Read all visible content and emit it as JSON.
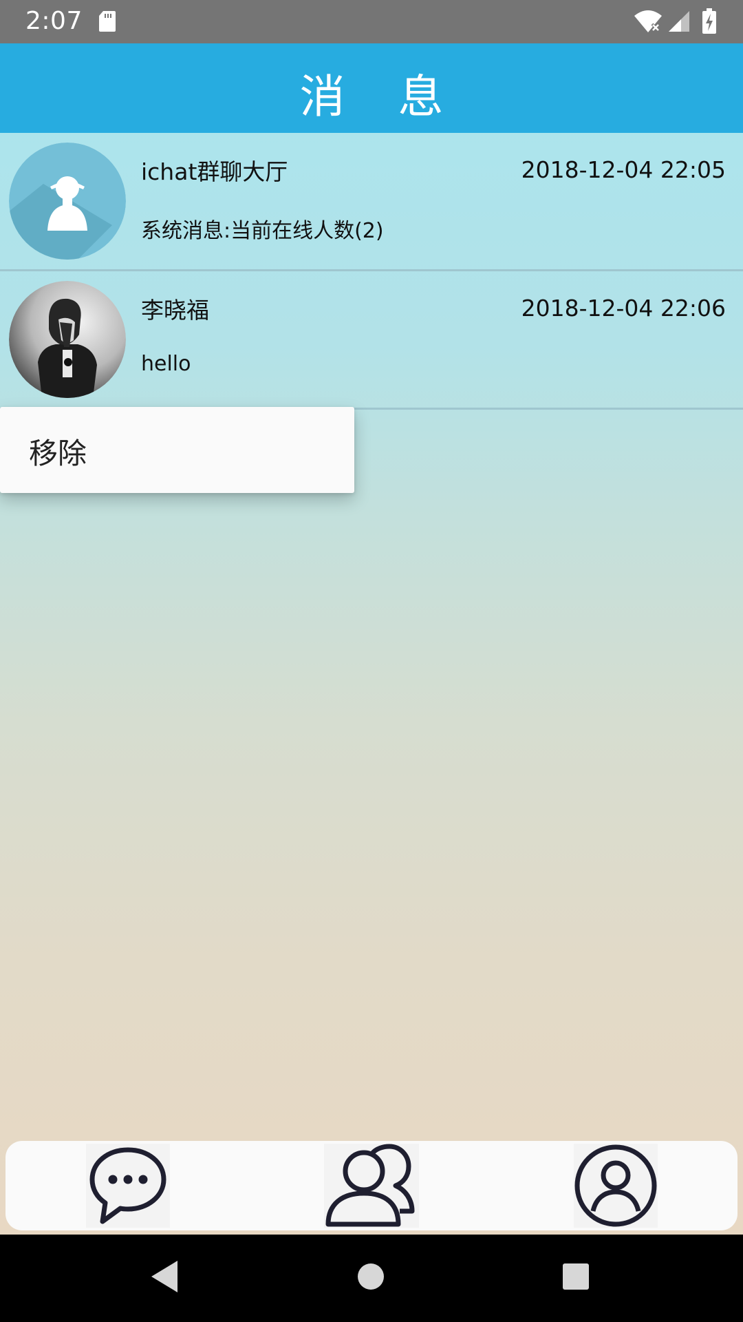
{
  "status_bar": {
    "time": "2:07",
    "icons": [
      "sd-card-icon",
      "wifi-icon",
      "signal-icon",
      "battery-charging-icon"
    ]
  },
  "header": {
    "title": "消 息"
  },
  "chats": [
    {
      "name": "ichat群聊大厅",
      "time": "2018-12-04 22:05",
      "preview": "系统消息:当前在线人数(2)",
      "avatar": "default-person-icon"
    },
    {
      "name": "李晓福",
      "time": "2018-12-04 22:06",
      "preview": "hello",
      "avatar": "user-photo"
    }
  ],
  "context_menu": {
    "items": [
      "移除"
    ]
  },
  "bottom_nav": {
    "items": [
      "messages-icon",
      "contacts-icon",
      "profile-icon"
    ]
  },
  "colors": {
    "status_bar": "#757575",
    "header": "#27ace0",
    "list_top": "#a9e5ef",
    "background_bottom": "#e8d8c3",
    "nav_icon": "#1f1f30"
  }
}
